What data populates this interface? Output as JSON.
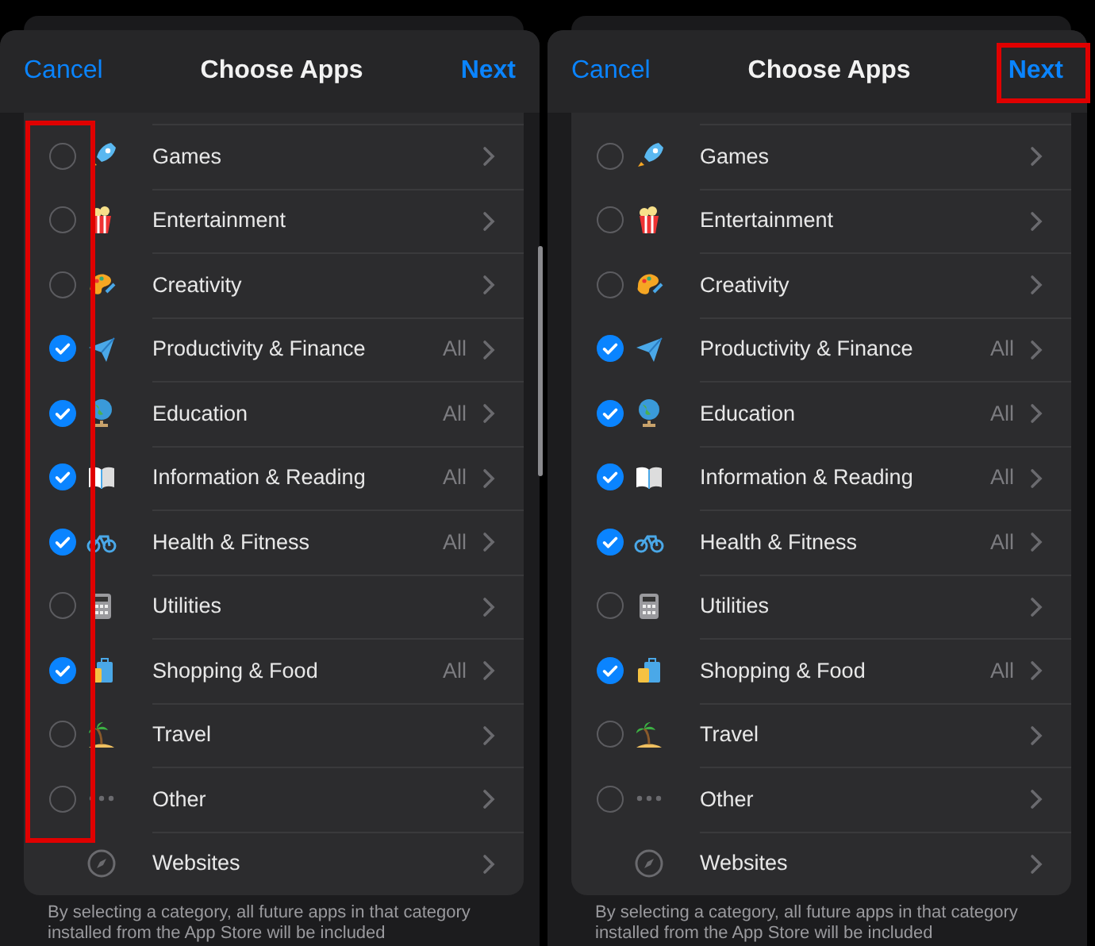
{
  "panels": [
    {
      "cancel": "Cancel",
      "title": "Choose Apps",
      "next": "Next",
      "checkboxes_highlighted": true,
      "next_highlighted": false,
      "scroll_indicator": true,
      "categories": [
        {
          "label": "Games",
          "checked": false
        },
        {
          "label": "Entertainment",
          "checked": false
        },
        {
          "label": "Creativity",
          "checked": false
        },
        {
          "label": "Productivity & Finance",
          "checked": true,
          "detail": "All"
        },
        {
          "label": "Education",
          "checked": true,
          "detail": "All"
        },
        {
          "label": "Information & Reading",
          "checked": true,
          "detail": "All"
        },
        {
          "label": "Health & Fitness",
          "checked": true,
          "detail": "All"
        },
        {
          "label": "Utilities",
          "checked": false
        },
        {
          "label": "Shopping & Food",
          "checked": true,
          "detail": "All"
        },
        {
          "label": "Travel",
          "checked": false
        },
        {
          "label": "Other",
          "checked": false
        },
        {
          "label": "Websites"
        }
      ],
      "footer": "By selecting a category, all future apps in that category installed from the App Store will be included"
    },
    {
      "cancel": "Cancel",
      "title": "Choose Apps",
      "next": "Next",
      "checkboxes_highlighted": false,
      "next_highlighted": true,
      "scroll_indicator": false,
      "categories": [
        {
          "label": "Games",
          "checked": false
        },
        {
          "label": "Entertainment",
          "checked": false
        },
        {
          "label": "Creativity",
          "checked": false
        },
        {
          "label": "Productivity & Finance",
          "checked": true,
          "detail": "All"
        },
        {
          "label": "Education",
          "checked": true,
          "detail": "All"
        },
        {
          "label": "Information & Reading",
          "checked": true,
          "detail": "All"
        },
        {
          "label": "Health & Fitness",
          "checked": true,
          "detail": "All"
        },
        {
          "label": "Utilities",
          "checked": false
        },
        {
          "label": "Shopping & Food",
          "checked": true,
          "detail": "All"
        },
        {
          "label": "Travel",
          "checked": false
        },
        {
          "label": "Other",
          "checked": false
        },
        {
          "label": "Websites"
        }
      ],
      "footer": "By selecting a category, all future apps in that category installed from the App Store will be included"
    }
  ]
}
